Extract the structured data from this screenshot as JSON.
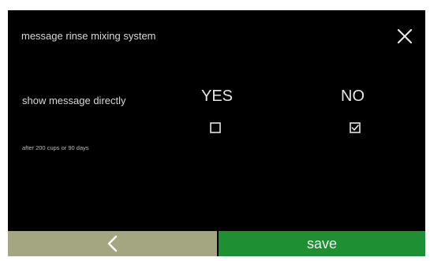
{
  "screen": {
    "title": "message rinse mixing system"
  },
  "setting": {
    "label": "show message directly",
    "sublabel": "after 200 cups or 90 days"
  },
  "options": {
    "yes_label": "YES",
    "no_label": "NO",
    "yes_checked": false,
    "no_checked": true
  },
  "footer": {
    "back_icon": "chevron-left-icon",
    "save_label": "save"
  },
  "colors": {
    "background": "#000000",
    "back_button": "#a3a680",
    "save_button": "#1e8f32"
  }
}
